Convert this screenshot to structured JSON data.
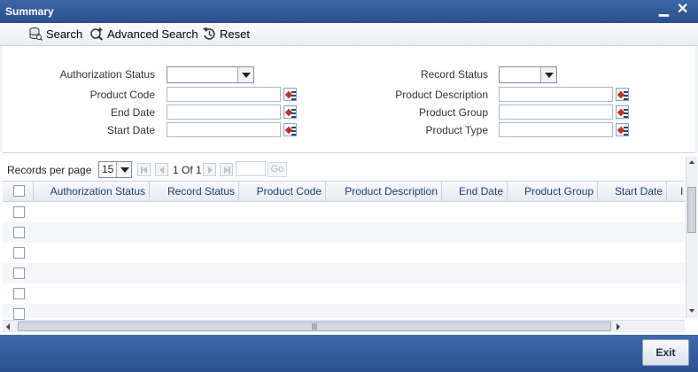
{
  "window": {
    "title": "Summary"
  },
  "toolbar": {
    "search_label": "Search",
    "advanced_search_label": "Advanced Search",
    "reset_label": "Reset"
  },
  "form": {
    "authorization_status_label": "Authorization Status",
    "authorization_status_value": "",
    "record_status_label": "Record Status",
    "record_status_value": "",
    "product_code_label": "Product Code",
    "product_code_value": "",
    "product_description_label": "Product Description",
    "product_description_value": "",
    "end_date_label": "End Date",
    "end_date_value": "",
    "product_group_label": "Product Group",
    "product_group_value": "",
    "start_date_label": "Start Date",
    "start_date_value": "",
    "product_type_label": "Product Type",
    "product_type_value": ""
  },
  "pager": {
    "records_per_page_label": "Records per page",
    "records_per_page_value": "15",
    "page_of": "1 Of 1",
    "go_label": "Go"
  },
  "table": {
    "columns": [
      "Authorization Status",
      "Record Status",
      "Product Code",
      "Product Description",
      "End Date",
      "Product Group",
      "Start Date",
      "I"
    ],
    "rows": [
      [],
      [],
      [],
      [],
      [],
      []
    ]
  },
  "footer": {
    "exit_label": "Exit"
  },
  "colors": {
    "titlebar": "#2f5797",
    "header_text": "#1a3d78",
    "footer": "#2b5190"
  }
}
